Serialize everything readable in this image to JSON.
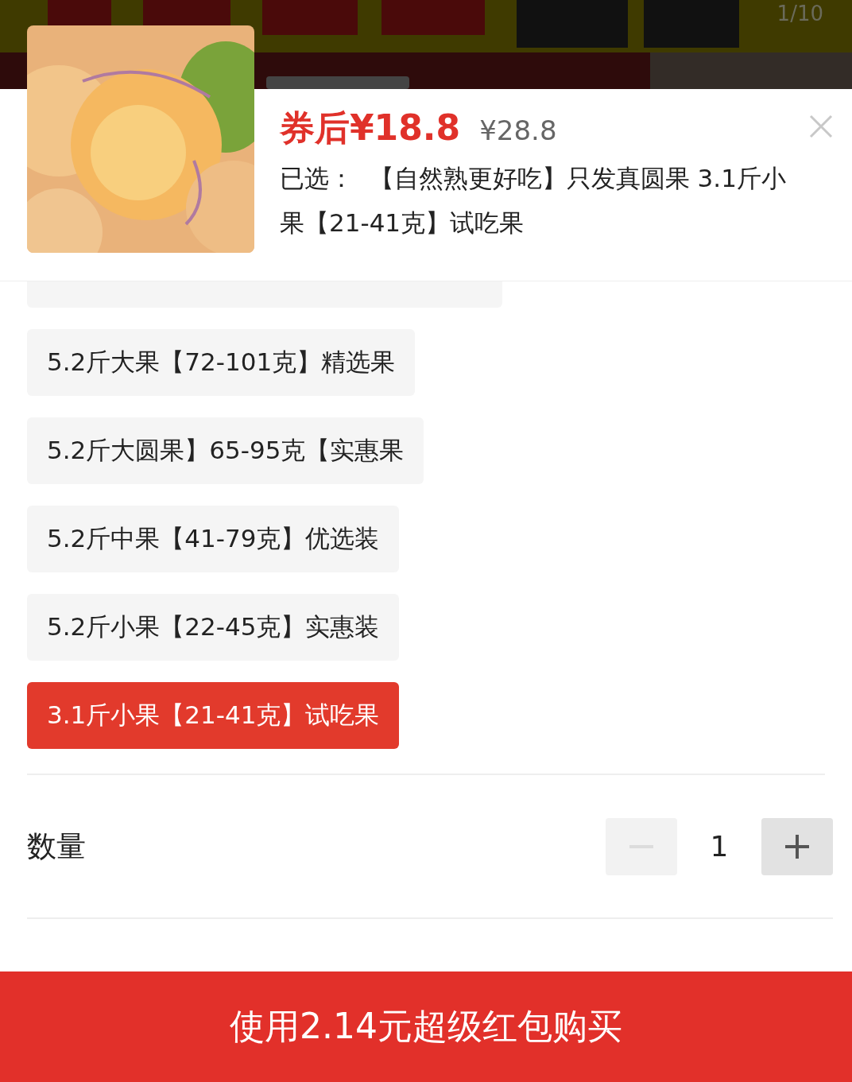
{
  "backdrop": {
    "counter": "1/10"
  },
  "product": {
    "price": "券后¥18.8",
    "original_price": "¥28.8",
    "selected_label": "已选：",
    "selected_value": "【自然熟更好吃】只发真圆果 3.1斤小果【21-41克】试吃果"
  },
  "options": [
    {
      "label": "5.2斤大果【72-101克】精选果",
      "selected": false
    },
    {
      "label": "5.2斤大圆果】65-95克【实惠果",
      "selected": false
    },
    {
      "label": "5.2斤中果【41-79克】优选装",
      "selected": false
    },
    {
      "label": "5.2斤小果【22-45克】实惠装",
      "selected": false
    },
    {
      "label": "3.1斤小果【21-41克】试吃果",
      "selected": true
    }
  ],
  "quantity": {
    "label": "数量",
    "value": "1",
    "minus_disabled": true
  },
  "buy_button": "使用2.14元超级红包购买"
}
